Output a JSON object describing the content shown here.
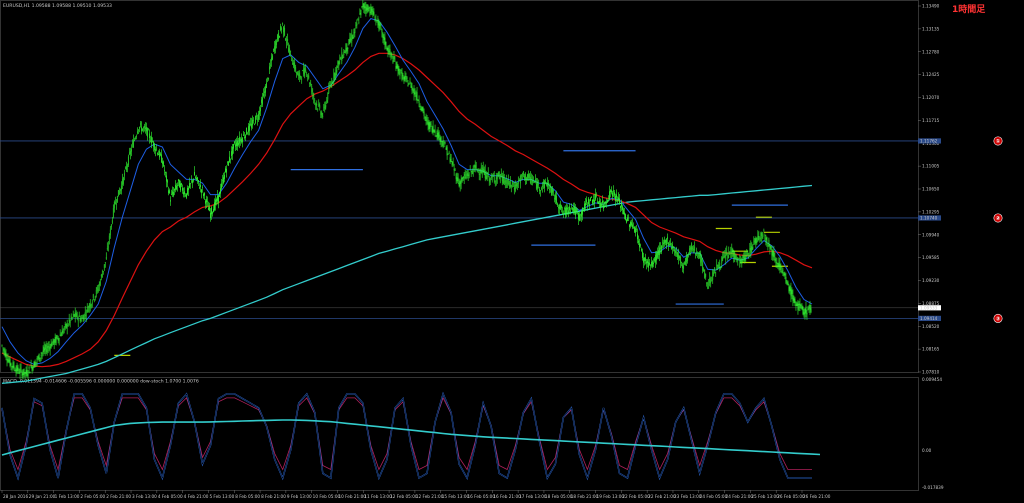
{
  "chart_data": {
    "type": "candlestick",
    "symbol_header": "EURUSD,H1  1.09588 1.09588 1.09510 1.09533",
    "timeframe_tag": "1時間足",
    "colors": {
      "background": "#000000",
      "candles": "#33ff33",
      "ma_fast": "#1e5fe6",
      "ma_mid": "#dd1111",
      "ma_slow": "#33cccc",
      "hlines": "#2a4a8a",
      "tag": "#ff3333",
      "zone_blue": "#2f6fe0",
      "zone_yellow": "#b8d200",
      "macd_main": "#33cccc",
      "stoch_a": "#2f6fe0",
      "stoch_b": "#b0205a",
      "price_box": "#2a4a8a"
    },
    "price_axis": {
      "ylim": [
        1.087,
        1.136
      ],
      "ticks": [
        "1.13490",
        "1.13135",
        "1.12780",
        "1.12425",
        "1.12070",
        "1.11715",
        "1.11360",
        "1.11005",
        "1.10650",
        "1.10295",
        "1.09940",
        "1.09585",
        "1.09230",
        "1.08875",
        "1.08520",
        "1.08165",
        "1.07810"
      ],
      "price_box_labels": [
        "1.11762",
        "1.10740",
        "1.09533",
        "1.09414"
      ]
    },
    "time_axis": {
      "labels": [
        "28 Jan 2016",
        "29 Jan 21:00",
        "1 Feb 13:00",
        "2 Feb 05:00",
        "2 Feb 21:00",
        "3 Feb 13:00",
        "4 Feb 05:00",
        "4 Feb 21:00",
        "5 Feb 13:00",
        "8 Feb 05:00",
        "8 Feb 21:00",
        "9 Feb 13:00",
        "10 Feb 05:00",
        "10 Feb 21:00",
        "11 Feb 13:00",
        "12 Feb 05:00",
        "12 Feb 21:00",
        "15 Feb 13:00",
        "16 Feb 05:00",
        "16 Feb 21:00",
        "17 Feb 13:00",
        "18 Feb 05:00",
        "18 Feb 21:00",
        "19 Feb 13:00",
        "22 Feb 05:00",
        "22 Feb 21:00",
        "23 Feb 13:00",
        "24 Feb 05:00",
        "24 Feb 21:00",
        "25 Feb 13:00",
        "26 Feb 05:00",
        "26 Feb 21:00"
      ]
    },
    "hlines": [
      {
        "label": "①",
        "price_label": "1.11762",
        "value": 1.1176
      },
      {
        "label": "②",
        "price_label": "1.10740",
        "value": 1.1074
      },
      {
        "label": "③",
        "price_label": "1.09414",
        "value": 1.0941
      }
    ],
    "current_price_line": 1.0955,
    "sub_panel": {
      "header": "MACD -0.011394 -0.014606 -0.005596 0.000000 0.000000  dow-stoch 1.0700 1.0076",
      "axis_ticks": [
        "0.009454",
        "0.00",
        "-0.017839"
      ]
    },
    "close_series": [
      1.0905,
      1.0882,
      1.0872,
      1.0868,
      1.088,
      1.0895,
      1.0905,
      1.0915,
      1.093,
      1.0945,
      1.094,
      1.096,
      1.098,
      1.102,
      1.109,
      1.112,
      1.116,
      1.1195,
      1.119,
      1.117,
      1.115,
      1.11,
      1.112,
      1.1105,
      1.113,
      1.111,
      1.108,
      1.11,
      1.114,
      1.117,
      1.118,
      1.1195,
      1.121,
      1.125,
      1.13,
      1.133,
      1.129,
      1.126,
      1.127,
      1.123,
      1.121,
      1.125,
      1.128,
      1.13,
      1.132,
      1.1355,
      1.135,
      1.133,
      1.13,
      1.128,
      1.126,
      1.125,
      1.123,
      1.12,
      1.119,
      1.1175,
      1.115,
      1.112,
      1.113,
      1.114,
      1.1135,
      1.1125,
      1.113,
      1.112,
      1.1115,
      1.113,
      1.1125,
      1.1115,
      1.112,
      1.11,
      1.108,
      1.109,
      1.1075,
      1.1095,
      1.11,
      1.109,
      1.111,
      1.1095,
      1.107,
      1.106,
      1.102,
      1.101,
      1.103,
      1.1045,
      1.103,
      1.101,
      1.1035,
      1.1025,
      1.0985,
      1.1005,
      1.102,
      1.103,
      1.1015,
      1.1025,
      1.1045,
      1.1055,
      1.103,
      1.101,
      1.0985,
      1.096,
      1.095,
      1.0955
    ],
    "ma_fast_series": [
      1.093,
      1.091,
      1.0895,
      1.0885,
      1.088,
      1.0882,
      1.0888,
      1.0897,
      1.091,
      1.0922,
      1.0932,
      1.0945,
      1.096,
      1.099,
      1.1035,
      1.1075,
      1.111,
      1.1145,
      1.1165,
      1.1172,
      1.1168,
      1.1145,
      1.1135,
      1.1125,
      1.1125,
      1.112,
      1.1105,
      1.1105,
      1.112,
      1.114,
      1.1158,
      1.1175,
      1.119,
      1.122,
      1.1255,
      1.1285,
      1.129,
      1.128,
      1.1275,
      1.126,
      1.1245,
      1.125,
      1.1265,
      1.128,
      1.13,
      1.1325,
      1.1338,
      1.1335,
      1.132,
      1.1302,
      1.1283,
      1.1268,
      1.1252,
      1.1228,
      1.121,
      1.1192,
      1.117,
      1.1145,
      1.1138,
      1.1138,
      1.1136,
      1.113,
      1.113,
      1.1126,
      1.1121,
      1.1125,
      1.1125,
      1.112,
      1.112,
      1.111,
      1.1095,
      1.1092,
      1.1084,
      1.1089,
      1.1094,
      1.1092,
      1.11,
      1.1098,
      1.1085,
      1.1072,
      1.1047,
      1.1028,
      1.1029,
      1.1037,
      1.1034,
      1.1022,
      1.1028,
      1.1027,
      1.1006,
      1.1005,
      1.1012,
      1.1021,
      1.1018,
      1.1021,
      1.1033,
      1.1044,
      1.1037,
      1.1023,
      1.1004,
      1.0982,
      1.0966,
      1.096
    ],
    "ma_mid_series": [
      1.0895,
      1.089,
      1.0885,
      1.088,
      1.0878,
      1.0877,
      1.0878,
      1.088,
      1.0884,
      1.0889,
      1.0894,
      1.09,
      1.091,
      1.0925,
      1.0945,
      1.0968,
      1.099,
      1.1012,
      1.103,
      1.1045,
      1.1056,
      1.1062,
      1.107,
      1.1075,
      1.1082,
      1.1088,
      1.109,
      1.1094,
      1.1102,
      1.1112,
      1.1122,
      1.1133,
      1.1145,
      1.116,
      1.1178,
      1.1198,
      1.1212,
      1.1222,
      1.1232,
      1.1238,
      1.1242,
      1.1248,
      1.1255,
      1.1262,
      1.127,
      1.128,
      1.1288,
      1.1292,
      1.1292,
      1.129,
      1.1285,
      1.1278,
      1.127,
      1.126,
      1.125,
      1.124,
      1.1228,
      1.1215,
      1.1205,
      1.1198,
      1.119,
      1.1182,
      1.1176,
      1.117,
      1.1163,
      1.1158,
      1.1152,
      1.1146,
      1.114,
      1.1133,
      1.1125,
      1.1119,
      1.1112,
      1.1108,
      1.1105,
      1.1101,
      1.1099,
      1.1097,
      1.1093,
      1.1088,
      1.1078,
      1.1068,
      1.1062,
      1.1058,
      1.1054,
      1.1049,
      1.1046,
      1.1043,
      1.1036,
      1.1031,
      1.1028,
      1.1027,
      1.1025,
      1.1024,
      1.1026,
      1.1029,
      1.103,
      1.1028,
      1.1024,
      1.1018,
      1.1012,
      1.1008
    ],
    "ma_slow_series": [
      1.0855,
      1.0856,
      1.0857,
      1.0858,
      1.086,
      1.0862,
      1.0864,
      1.0866,
      1.0868,
      1.0871,
      1.0874,
      1.0877,
      1.088,
      1.0884,
      1.0889,
      1.0894,
      1.0899,
      1.0904,
      1.0909,
      1.0914,
      1.0918,
      1.0922,
      1.0926,
      1.093,
      1.0934,
      1.0938,
      1.0941,
      1.0945,
      1.0949,
      1.0953,
      1.0957,
      1.0961,
      1.0965,
      1.0969,
      1.0974,
      1.0979,
      1.0983,
      1.0987,
      1.0991,
      1.0995,
      1.0999,
      1.1003,
      1.1007,
      1.1011,
      1.1015,
      1.1019,
      1.1023,
      1.1027,
      1.103,
      1.1033,
      1.1036,
      1.1039,
      1.1042,
      1.1045,
      1.1047,
      1.1049,
      1.1051,
      1.1053,
      1.1055,
      1.1057,
      1.1059,
      1.1061,
      1.1063,
      1.1065,
      1.1067,
      1.1069,
      1.1071,
      1.1073,
      1.1075,
      1.1077,
      1.1079,
      1.1081,
      1.1083,
      1.1085,
      1.1087,
      1.1089,
      1.1091,
      1.1093,
      1.1095,
      1.1096,
      1.1097,
      1.1098,
      1.1099,
      1.11,
      1.1101,
      1.1102,
      1.1103,
      1.1104,
      1.1104,
      1.1105,
      1.1106,
      1.1107,
      1.1108,
      1.1109,
      1.111,
      1.1111,
      1.1112,
      1.1113,
      1.1114,
      1.1115,
      1.1116,
      1.1117
    ],
    "macd_series": [
      -0.9,
      -0.8,
      -0.7,
      -0.6,
      -0.5,
      -0.4,
      -0.3,
      -0.2,
      -0.1,
      0.0,
      0.1,
      0.2,
      0.3,
      0.4,
      0.5,
      0.55,
      0.6,
      0.62,
      0.64,
      0.65,
      0.66,
      0.66,
      0.66,
      0.66,
      0.66,
      0.66,
      0.67,
      0.68,
      0.69,
      0.7,
      0.71,
      0.72,
      0.73,
      0.74,
      0.75,
      0.76,
      0.76,
      0.75,
      0.74,
      0.72,
      0.7,
      0.68,
      0.64,
      0.6,
      0.56,
      0.52,
      0.48,
      0.44,
      0.4,
      0.36,
      0.32,
      0.28,
      0.24,
      0.2,
      0.16,
      0.12,
      0.08,
      0.05,
      0.02,
      -0.01,
      -0.04,
      -0.06,
      -0.08,
      -0.1,
      -0.12,
      -0.14,
      -0.16,
      -0.18,
      -0.2,
      -0.22,
      -0.24,
      -0.26,
      -0.28,
      -0.3,
      -0.32,
      -0.34,
      -0.36,
      -0.38,
      -0.4,
      -0.42,
      -0.44,
      -0.46,
      -0.48,
      -0.5,
      -0.52,
      -0.54,
      -0.56,
      -0.58,
      -0.6,
      -0.62,
      -0.64,
      -0.66,
      -0.68,
      -0.7,
      -0.72,
      -0.74,
      -0.76,
      -0.78,
      -0.8,
      -0.82,
      -0.84,
      -0.86,
      -0.88
    ],
    "stoch_series": [
      0.6,
      -0.4,
      -0.9,
      -0.2,
      0.8,
      0.7,
      -0.3,
      -0.9,
      0.1,
      0.9,
      0.9,
      0.6,
      -0.2,
      -0.8,
      0.3,
      0.9,
      0.9,
      0.9,
      0.6,
      -0.5,
      -0.9,
      -0.2,
      0.7,
      0.9,
      0.3,
      -0.6,
      -0.2,
      0.8,
      0.9,
      0.9,
      0.8,
      0.7,
      0.6,
      0.2,
      -0.5,
      -0.9,
      -0.3,
      0.7,
      0.9,
      0.5,
      -0.8,
      -0.9,
      0.6,
      0.9,
      0.9,
      0.7,
      -0.3,
      -0.9,
      -0.5,
      0.6,
      0.8,
      -0.2,
      -0.9,
      -0.8,
      0.3,
      0.9,
      0.5,
      -0.6,
      -0.9,
      -0.2,
      0.7,
      0.2,
      -0.8,
      -0.9,
      -0.3,
      0.5,
      0.8,
      -0.1,
      -0.9,
      -0.6,
      0.4,
      0.6,
      -0.4,
      -0.9,
      -0.3,
      0.6,
      0.0,
      -0.8,
      -0.9,
      -0.2,
      0.4,
      -0.3,
      -0.9,
      -0.5,
      0.3,
      0.6,
      -0.1,
      -0.8,
      -0.2,
      0.5,
      0.9,
      0.9,
      0.7,
      0.3,
      0.6,
      0.8,
      0.2,
      -0.5,
      -0.9,
      -0.9,
      -0.9,
      -0.9
    ]
  }
}
